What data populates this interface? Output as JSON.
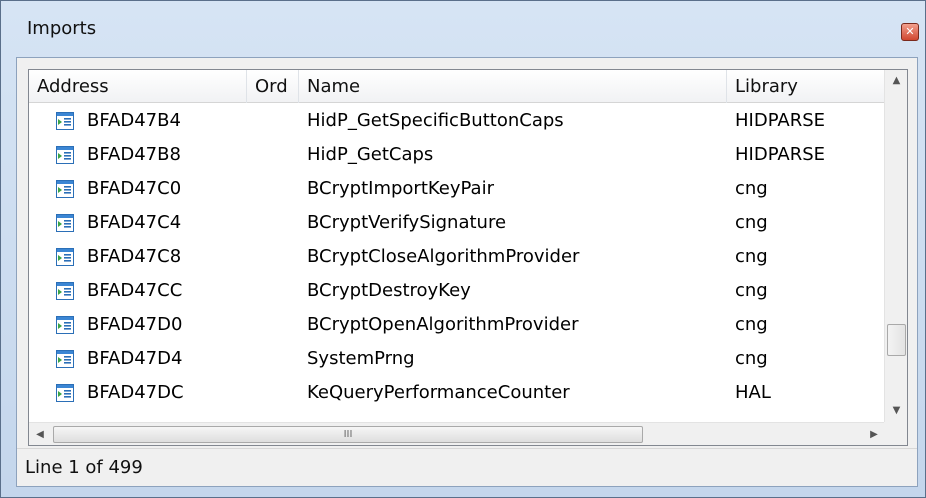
{
  "window": {
    "title": "Imports",
    "close_glyph": "✕"
  },
  "columns": {
    "address": "Address",
    "ord": "Ord",
    "name": "Name",
    "library": "Library"
  },
  "rows": [
    {
      "address": "BFAD47B4",
      "ord": "",
      "name": "HidP_GetSpecificButtonCaps",
      "library": "HIDPARSE",
      "icon": "import-function-icon"
    },
    {
      "address": "BFAD47B8",
      "ord": "",
      "name": "HidP_GetCaps",
      "library": "HIDPARSE",
      "icon": "import-function-icon"
    },
    {
      "address": "BFAD47C0",
      "ord": "",
      "name": "BCryptImportKeyPair",
      "library": "cng",
      "icon": "import-function-icon"
    },
    {
      "address": "BFAD47C4",
      "ord": "",
      "name": "BCryptVerifySignature",
      "library": "cng",
      "icon": "import-function-icon"
    },
    {
      "address": "BFAD47C8",
      "ord": "",
      "name": "BCryptCloseAlgorithmProvider",
      "library": "cng",
      "icon": "import-function-icon"
    },
    {
      "address": "BFAD47CC",
      "ord": "",
      "name": "BCryptDestroyKey",
      "library": "cng",
      "icon": "import-function-icon"
    },
    {
      "address": "BFAD47D0",
      "ord": "",
      "name": "BCryptOpenAlgorithmProvider",
      "library": "cng",
      "icon": "import-function-icon"
    },
    {
      "address": "BFAD47D4",
      "ord": "",
      "name": "SystemPrng",
      "library": "cng",
      "icon": "import-function-icon"
    },
    {
      "address": "BFAD47DC",
      "ord": "",
      "name": "KeQueryPerformanceCounter",
      "library": "HAL",
      "icon": "import-function-icon"
    }
  ],
  "scrollbars": {
    "up": "▲",
    "down": "▼",
    "left": "◀",
    "right": "▶",
    "grip": "III"
  },
  "status": {
    "text": "Line 1 of 499"
  }
}
